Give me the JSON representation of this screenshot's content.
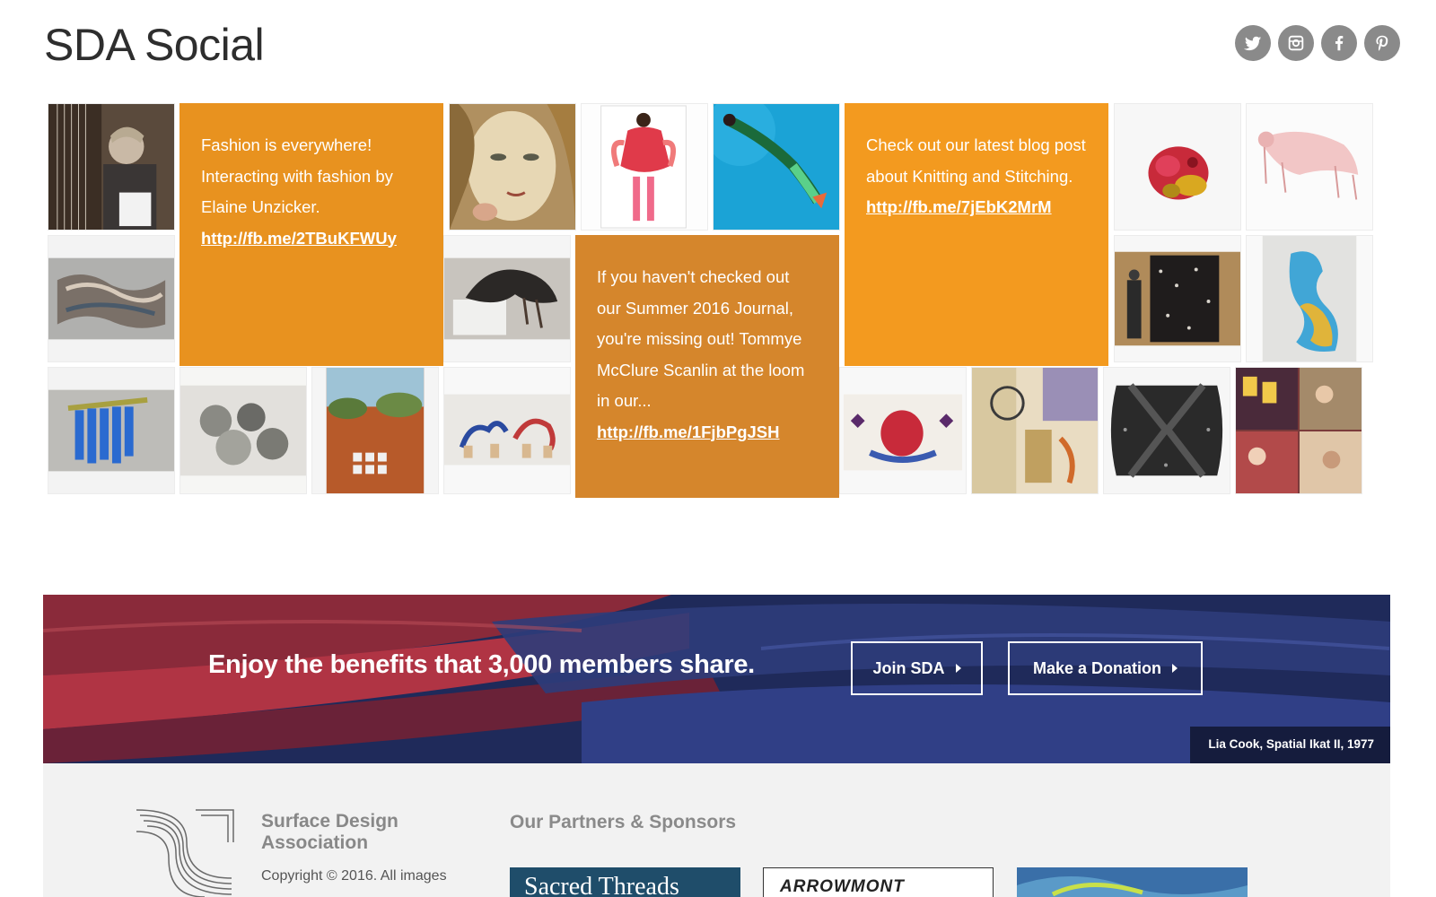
{
  "header": {
    "title": "SDA Social",
    "social_icons": [
      "twitter-icon",
      "instagram-icon",
      "facebook-icon",
      "pinterest-icon"
    ]
  },
  "posts": [
    {
      "text": "Fashion is everywhere! Interacting with fashion by Elaine Unzicker.",
      "link": "http://fb.me/2TBuKFWUy"
    },
    {
      "text": "If you haven't checked out our Summer 2016 Journal, you're missing out! Tommye McClure Scanlin at the loom in our...",
      "link": "http://fb.me/1FjbPgJSH"
    },
    {
      "text": "Check out our latest blog post about Knitting and Stitching.",
      "link": "http://fb.me/7jEbK2MrM"
    }
  ],
  "banner": {
    "headline": "Enjoy the benefits that 3,000 members share.",
    "join_label": "Join SDA",
    "donate_label": "Make a Donation",
    "caption": "Lia Cook, Spatial Ikat II, 1977"
  },
  "footer": {
    "org_name": "Surface Design Association",
    "copyright": "Copyright © 2016. All images",
    "partners_title": "Our Partners & Sponsors",
    "partners": [
      "Sacred Threads",
      "ARROWMONT"
    ]
  },
  "colors": {
    "post_orange_1": "#e8921f",
    "post_orange_2": "#d5862c",
    "post_orange_3": "#f39a1f",
    "social_grey": "#8a8a8a",
    "footer_bg": "#f2f2f2"
  }
}
